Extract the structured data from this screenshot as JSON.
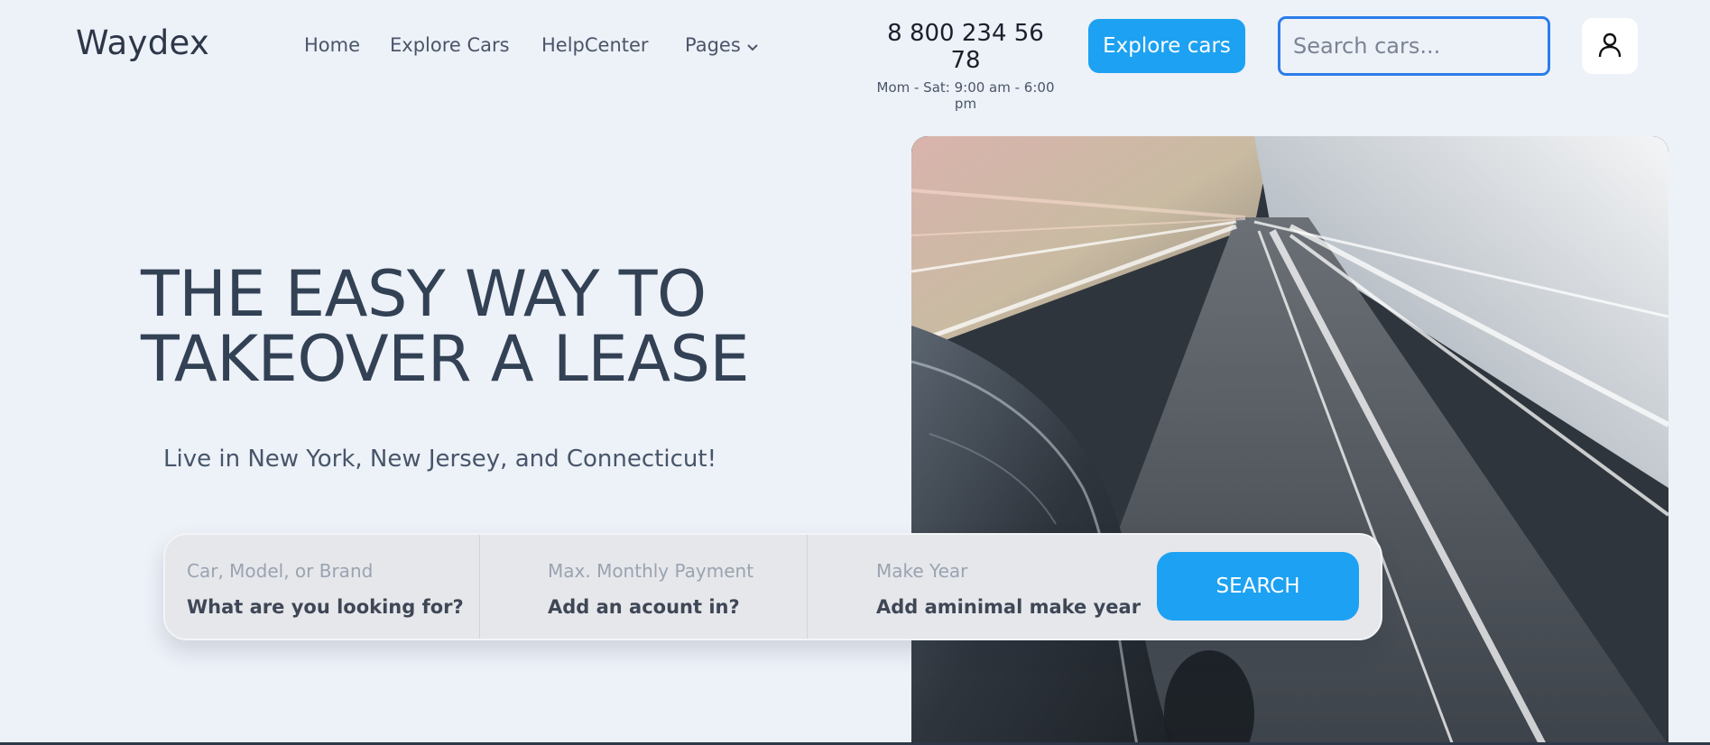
{
  "header": {
    "logo": "Waydex",
    "nav": [
      {
        "label": "Home"
      },
      {
        "label": "Explore Cars"
      },
      {
        "label": "HelpCenter"
      },
      {
        "label": "Pages"
      }
    ],
    "phone": "8 800 234 56 78",
    "hours": "Mom - Sat: 9:00 am - 6:00 pm",
    "explore_button": "Explore cars",
    "search_placeholder": "Search cars...",
    "icons": {
      "search": "search-icon",
      "user": "user-icon",
      "pages_dropdown": "chevron-down-icon"
    }
  },
  "hero": {
    "title_line1": "THE EASY WAY TO",
    "title_line2": "TAKEOVER A LEASE",
    "subtitle": "Live in New York, New Jersey, and Connecticut!",
    "image": "motion-blur-car-tunnel-photo"
  },
  "searchbar": {
    "fields": [
      {
        "label": "Car, Model, or Brand",
        "value": "What are you looking for?"
      },
      {
        "label": "Max. Monthly Payment",
        "value": "Add an acount in?"
      },
      {
        "label": "Make Year",
        "value": "Add aminimal make year"
      }
    ],
    "button": "SEARCH"
  },
  "colors": {
    "background": "#edf1f8",
    "accent": "#1da1f2",
    "search_border": "#2b7de9",
    "text_dark": "#334155"
  }
}
